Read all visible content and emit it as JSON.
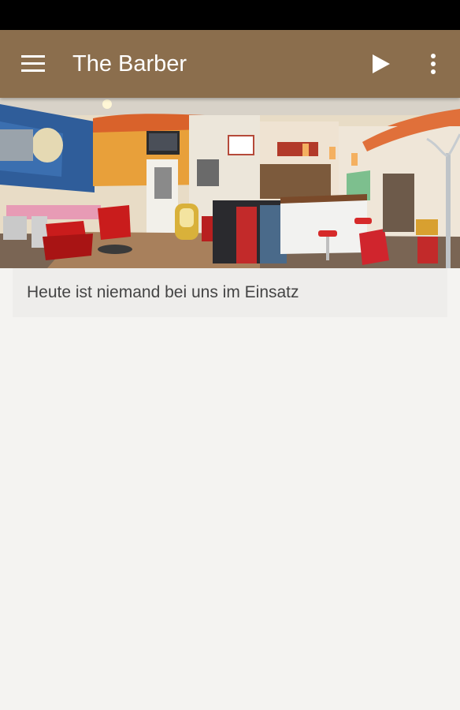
{
  "app_bar": {
    "title": "The Barber",
    "background_color": "#8b6e4d",
    "menu_icon": "hamburger-menu-icon",
    "play_icon": "play-icon",
    "overflow_icon": "more-vert-icon"
  },
  "hero": {
    "subject": "barbershop-interior-panorama-photo"
  },
  "info": {
    "message": "Heute ist niemand bei uns im Einsatz"
  }
}
